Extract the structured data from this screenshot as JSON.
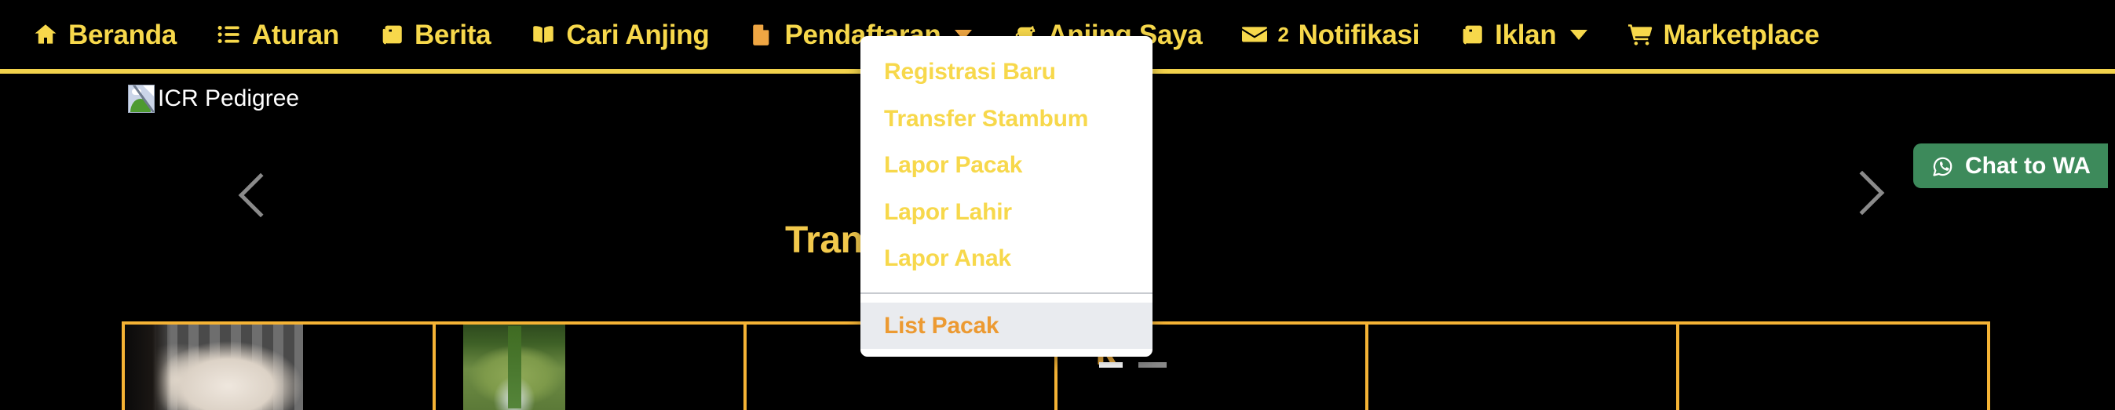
{
  "colors": {
    "nav_bg": "#000000",
    "nav_text": "#F7D84B",
    "nav_rule": "#F2D24B",
    "dropdown_bg": "#FFFFFF",
    "dropdown_text": "#F7D84B",
    "dropdown_active_bg": "#E9EBEF",
    "dropdown_active_text": "#EC9A32",
    "accent_orange": "#EFA643",
    "thumb_border": "#F5B335",
    "wa_green": "#3D8A5B",
    "chevron_gray": "#8A8A8A"
  },
  "navbar": {
    "items": [
      {
        "label": "Beranda",
        "icon": "home-icon",
        "has_caret": false
      },
      {
        "label": "Aturan",
        "icon": "list-icon",
        "has_caret": false
      },
      {
        "label": "Berita",
        "icon": "newspaper-icon",
        "has_caret": false
      },
      {
        "label": "Cari Anjing",
        "icon": "book-open-icon",
        "has_caret": false
      },
      {
        "label": "Pendaftaran",
        "icon": "document-icon",
        "has_caret": true
      },
      {
        "label": "Anjing Saya",
        "icon": "dog-icon",
        "has_caret": false
      },
      {
        "label": "2 Notifikasi",
        "icon": "envelope-icon",
        "has_caret": false,
        "count": "2",
        "text": "Notifikasi"
      },
      {
        "label": "Iklan",
        "icon": "newspaper-icon",
        "has_caret": true
      },
      {
        "label": "Marketplace",
        "icon": "shopping-cart-icon",
        "has_caret": false
      }
    ]
  },
  "dropdown": {
    "open_for": "Pendaftaran",
    "items": [
      {
        "label": "Registrasi Baru",
        "active": false
      },
      {
        "label": "Transfer Stambum",
        "active": false
      },
      {
        "label": "Lapor Pacak",
        "active": false
      },
      {
        "label": "Lapor Lahir",
        "active": false
      },
      {
        "label": "Lapor Anak",
        "active": false
      }
    ],
    "divider_after_index": 4,
    "items_after_divider": [
      {
        "label": "List Pacak",
        "active": true
      }
    ]
  },
  "hero": {
    "broken_image_alt": "ICR Pedigree",
    "headline_partial": "Transfer Stambum",
    "subtext_partial": "k",
    "prev_label": "Previous slide",
    "next_label": "Next slide",
    "indicators": [
      {
        "active": true
      },
      {
        "active": false
      }
    ]
  },
  "whatsapp": {
    "label": "Chat to WA",
    "icon": "whatsapp-icon"
  },
  "thumbnails": {
    "cells": [
      {
        "kind": "photo",
        "subject": "white-dog-portrait"
      },
      {
        "kind": "photo",
        "subject": "dog-in-garden"
      },
      {
        "kind": "empty",
        "subject": ""
      },
      {
        "kind": "empty",
        "subject": ""
      },
      {
        "kind": "empty",
        "subject": ""
      },
      {
        "kind": "empty",
        "subject": ""
      }
    ]
  }
}
